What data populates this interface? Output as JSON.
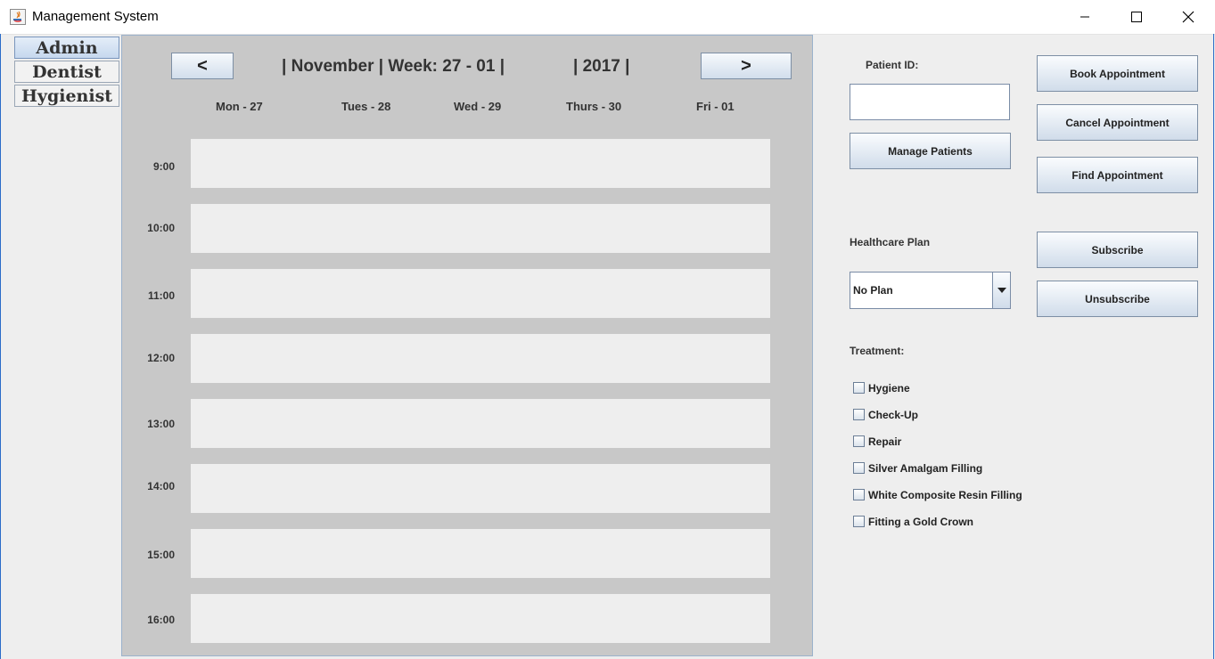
{
  "window": {
    "title": "Management System"
  },
  "tabs": [
    "Admin",
    "Dentist",
    "Hygienist"
  ],
  "calendar": {
    "prev_label": "<",
    "next_label": ">",
    "month_week": "| November | Week: 27 - 01 |",
    "year": "| 2017 |",
    "days": [
      "Mon - 27",
      "Tues - 28",
      "Wed - 29",
      "Thurs - 30",
      "Fri - 01"
    ],
    "times": [
      "9:00",
      "10:00",
      "11:00",
      "12:00",
      "13:00",
      "14:00",
      "15:00",
      "16:00"
    ]
  },
  "patient": {
    "id_label": "Patient ID:",
    "id_value": "",
    "manage_label": "Manage Patients"
  },
  "actions": {
    "book": "Book Appointment",
    "cancel": "Cancel Appointment",
    "find": "Find Appointment",
    "subscribe": "Subscribe",
    "unsubscribe": "Unsubscribe"
  },
  "plan": {
    "label": "Healthcare Plan",
    "selected": "No Plan"
  },
  "treatment": {
    "label": "Treatment:",
    "options": [
      "Hygiene",
      "Check-Up",
      "Repair",
      "Silver Amalgam Filling",
      "White Composite Resin Filling",
      "Fitting a Gold Crown"
    ]
  }
}
